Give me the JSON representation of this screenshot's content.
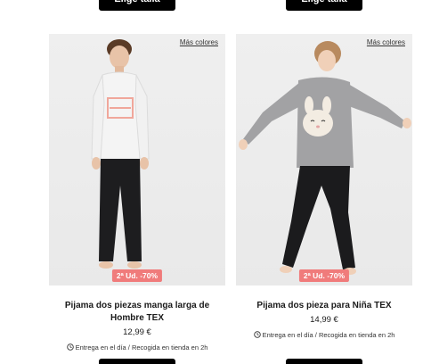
{
  "top_buttons": {
    "label": "Elige talla"
  },
  "products": [
    {
      "more_colors": "Más colores",
      "promo": "2ª Ud. -70%",
      "name": "Pijama dos piezas manga larga de Hombre TEX",
      "price": "12,99 €",
      "delivery": "Entrega en el día / Recogida en tienda en 2h"
    },
    {
      "more_colors": "Más colores",
      "promo": "2ª Ud. -70%",
      "name": "Pijama dos pieza para Niña TEX",
      "price": "14,99 €",
      "delivery": "Entrega en el día / Recogida en tienda en 2h"
    }
  ],
  "colors": {
    "promo_badge": "#f07b7b",
    "button": "#000000"
  }
}
